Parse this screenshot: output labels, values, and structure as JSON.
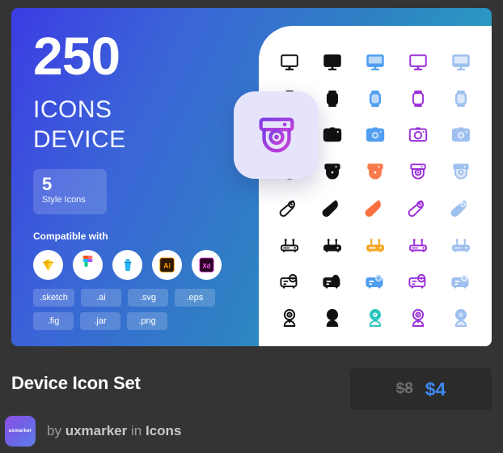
{
  "promo": {
    "count": "250",
    "heading_line1": "ICONS",
    "heading_line2": "DEVICE",
    "style_count": "5",
    "style_label": "Style Icons",
    "compatible_title": "Compatible with",
    "apps": [
      {
        "name": "sketch-app-icon",
        "label": "Sketch"
      },
      {
        "name": "figma-app-icon",
        "label": "Figma"
      },
      {
        "name": "jar-app-icon",
        "label": "Jar"
      },
      {
        "name": "adobe-illustrator-app-icon",
        "label": "Ai"
      },
      {
        "name": "adobe-xd-app-icon",
        "label": "Xd"
      }
    ],
    "formats_row1": [
      ".sketch",
      ".ai",
      ".svg",
      ".eps"
    ],
    "formats_row2": [
      ".fig",
      ".jar",
      ".png"
    ]
  },
  "featured_icon": {
    "name": "dome-security-camera-icon",
    "gradient_start": "#7b3fe4",
    "gradient_end": "#c040d8",
    "tile_color": "#e6e4fb"
  },
  "icon_grid": {
    "styles": [
      "outline",
      "solid",
      "duotone-blue",
      "outline-purple",
      "flat-blue"
    ],
    "rows": [
      {
        "name": "desktop-monitor-icon",
        "label": "Desktop Monitor"
      },
      {
        "name": "smartwatch-icon",
        "label": "Smartwatch"
      },
      {
        "name": "camera-icon",
        "label": "Camera"
      },
      {
        "name": "dome-security-camera-icon",
        "label": "Dome Security Camera"
      },
      {
        "name": "computer-mouse-icon",
        "label": "Computer Mouse"
      },
      {
        "name": "wifi-router-icon",
        "label": "Wi-Fi Router"
      },
      {
        "name": "projector-icon",
        "label": "Projector"
      },
      {
        "name": "webcam-icon",
        "label": "Webcam"
      }
    ]
  },
  "footer": {
    "title": "Device Icon Set",
    "price_old": "$8",
    "price_new": "$4",
    "by_word": "by",
    "author": "uxmarker",
    "in_word": "in",
    "category": "Icons",
    "avatar_label": "uxmarker",
    "price_new_color": "#3d8bf2"
  }
}
